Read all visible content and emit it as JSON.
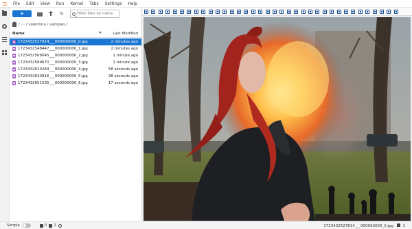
{
  "menubar": {
    "items": [
      "File",
      "Edit",
      "View",
      "Run",
      "Kernel",
      "Tabs",
      "Settings",
      "Help"
    ]
  },
  "rail": {
    "icons": [
      "folder-icon",
      "running-icon",
      "toc-icon",
      "extension-icon"
    ]
  },
  "filebrowser": {
    "new_button_label": "+",
    "filter_placeholder": "Filter files by name",
    "breadcrumb": "/ ··· / valentina / samples /",
    "header": {
      "name": "Name",
      "last_modified": "Last Modified"
    },
    "files": [
      {
        "name": "1723432527814___000000000_0.jpg",
        "modified": "2 minutes ago",
        "selected": true
      },
      {
        "name": "1723432548447___000000000_1.jpg",
        "modified": "2 minutes ago",
        "selected": false
      },
      {
        "name": "1723432569045___000000000_2.jpg",
        "modified": "1 minute ago",
        "selected": false
      },
      {
        "name": "1723432589670___000000000_3.jpg",
        "modified": "1 minute ago",
        "selected": false
      },
      {
        "name": "1723432610284___000000000_4.jpg",
        "modified": "58 seconds ago",
        "selected": false
      },
      {
        "name": "1723432630916___000000000_5.jpg",
        "modified": "38 seconds ago",
        "selected": false
      },
      {
        "name": "1723432651535___000000000_6.jpg",
        "modified": "17 seconds ago",
        "selected": false
      }
    ]
  },
  "viewer": {
    "toolbar_button_count": 36,
    "colors": {
      "hair": "#a3241c",
      "fire": "#f5a13a",
      "grass": "#5b6b2c",
      "coat": "#1e1f23"
    }
  },
  "statusbar": {
    "mode_label": "Simple",
    "count_a": "0",
    "count_b": "2",
    "filename": "1723432527814___000000000_0.jpg",
    "count_c": "1"
  },
  "colors": {
    "accent": "#1976d2"
  }
}
